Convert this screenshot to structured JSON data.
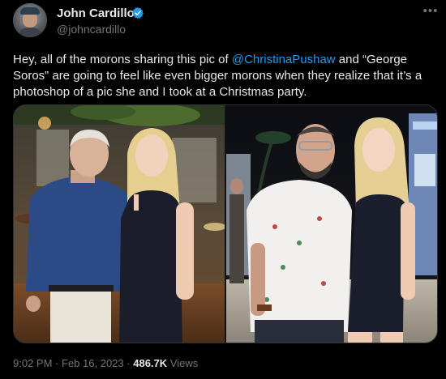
{
  "author": {
    "name": "John Cardillo",
    "handle": "@johncardillo"
  },
  "tweet": {
    "text_before": "Hey, all of the morons sharing this pic of ",
    "mention": "@ChristinaPushaw",
    "text_after": " and “George Soros” are going to feel like even bigger morons when they realize that it’s a photoshop of a pic she and I took at a Christmas party."
  },
  "meta": {
    "time": "9:02 PM",
    "separator": "·",
    "date": "Feb 16, 2023",
    "views_count": "486.7K",
    "views_label": "Views"
  },
  "icons": {
    "verified": "verified-badge-icon",
    "more": "more-options-icon"
  },
  "colors": {
    "background": "#000000",
    "link": "#1d9bf0",
    "verified": "#1d9bf0",
    "secondary_text": "#71767b"
  }
}
